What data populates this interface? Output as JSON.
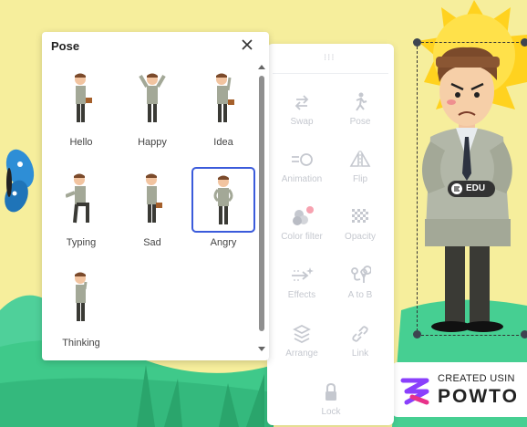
{
  "pose_panel": {
    "title": "Pose",
    "poses": [
      {
        "label": "Hello",
        "selected": false
      },
      {
        "label": "Happy",
        "selected": false
      },
      {
        "label": "Idea",
        "selected": false
      },
      {
        "label": "Typing",
        "selected": false
      },
      {
        "label": "Sad",
        "selected": false
      },
      {
        "label": "Angry",
        "selected": true
      },
      {
        "label": "Thinking",
        "selected": false
      }
    ]
  },
  "tools": [
    {
      "label": "Swap",
      "icon": "swap-icon"
    },
    {
      "label": "Pose",
      "icon": "pose-icon"
    },
    {
      "label": "Animation",
      "icon": "animation-icon"
    },
    {
      "label": "Flip",
      "icon": "flip-icon"
    },
    {
      "label": "Color filter",
      "icon": "color-filter-icon"
    },
    {
      "label": "Opacity",
      "icon": "opacity-icon"
    },
    {
      "label": "Effects",
      "icon": "effects-icon"
    },
    {
      "label": "A to B",
      "icon": "a-to-b-icon"
    },
    {
      "label": "Arrange",
      "icon": "arrange-icon"
    },
    {
      "label": "Link",
      "icon": "link-icon"
    },
    {
      "label": "Lock",
      "icon": "lock-icon"
    }
  ],
  "canvas": {
    "badge": "EDU",
    "watermark_line1": "CREATED USIN",
    "watermark_line2": "POWTO"
  },
  "colors": {
    "sky": "#f6ee9c",
    "grass": "#3fcf8e",
    "grass_dark": "#2fb67a",
    "selection_accent": "#3b5bdb",
    "tool_icon": "#c5c8cf"
  }
}
